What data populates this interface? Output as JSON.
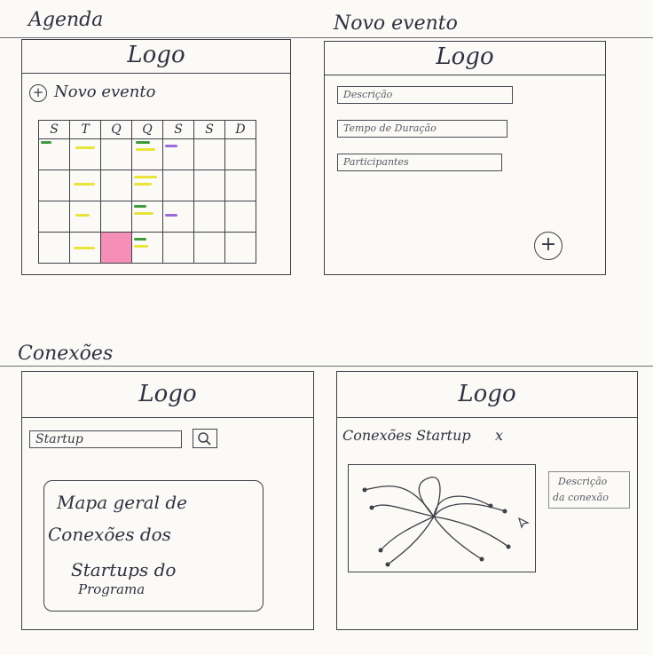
{
  "agenda": {
    "section_title": "Agenda",
    "logo": "Logo",
    "new_event_label": "Novo evento",
    "weekdays": [
      "S",
      "T",
      "Q",
      "Q",
      "S",
      "S",
      "D"
    ]
  },
  "novo_evento": {
    "section_title": "Novo evento",
    "logo": "Logo",
    "fields": [
      "Descrição",
      "Tempo de Duração",
      "Participantes"
    ],
    "add_symbol": "+"
  },
  "conexoes": {
    "section_title": "Conexões",
    "logo": "Logo",
    "search_value": "Startup",
    "map_lines": [
      "Mapa geral de",
      "Conexões dos",
      "Startups do",
      "Programa"
    ]
  },
  "conexoes_startup": {
    "logo": "Logo",
    "title": "Conexões Startup",
    "close_symbol": "x",
    "description_lines": [
      "Descrição",
      "da conexão"
    ]
  },
  "colors": {
    "line": "#3f3f4a",
    "highlight_green": "#3d9a3d",
    "highlight_yellow": "#e8e43a",
    "highlight_purple": "#9a6ad8",
    "highlight_pink": "#f58fb8"
  }
}
